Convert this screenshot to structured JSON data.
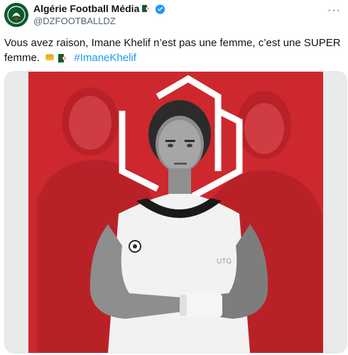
{
  "author": {
    "display_name": "Algérie Football Média",
    "handle": "@DZFOOTBALLDZ",
    "avatar_icon": "team-crest-icon",
    "flag_icon": "algeria-flag-icon",
    "verified_icon": "verified-badge-icon"
  },
  "tweet": {
    "text_line1": "Vous avez raison, Imane Khelif n’est pas une femme, c’est une SUPER",
    "text_line2": "femme.",
    "hashtag": "#ImaneKhelif",
    "emojis": [
      "fist-emoji",
      "algeria-flag-emoji"
    ]
  },
  "media": {
    "image_icon": "boxer-poster-image",
    "colors": {
      "red": "#d42a2f",
      "dark_red": "#a81d22",
      "white": "#ffffff",
      "frame": "#e9eaea"
    }
  },
  "colors": {
    "link": "#1d9bf0",
    "verified": "#1d9bf0",
    "secondary_text": "#536471"
  }
}
